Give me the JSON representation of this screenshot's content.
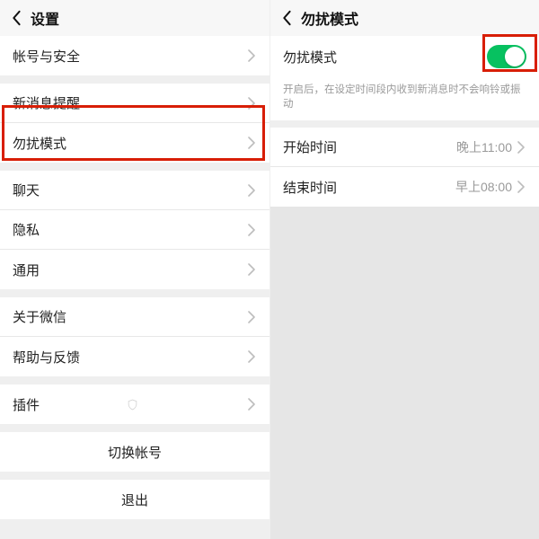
{
  "left": {
    "title": "设置",
    "rows": {
      "account": "帐号与安全",
      "notify": "新消息提醒",
      "dnd": "勿扰模式",
      "chat": "聊天",
      "privacy": "隐私",
      "general": "通用",
      "about": "关于微信",
      "help": "帮助与反馈",
      "plugins": "插件",
      "switch": "切换帐号",
      "logout": "退出"
    }
  },
  "right": {
    "title": "勿扰模式",
    "toggleLabel": "勿扰模式",
    "desc": "开启后，在设定时间段内收到新消息时不会响铃或振动",
    "startLabel": "开始时间",
    "startValue": "晚上11:00",
    "endLabel": "结束时间",
    "endValue": "早上08:00"
  }
}
